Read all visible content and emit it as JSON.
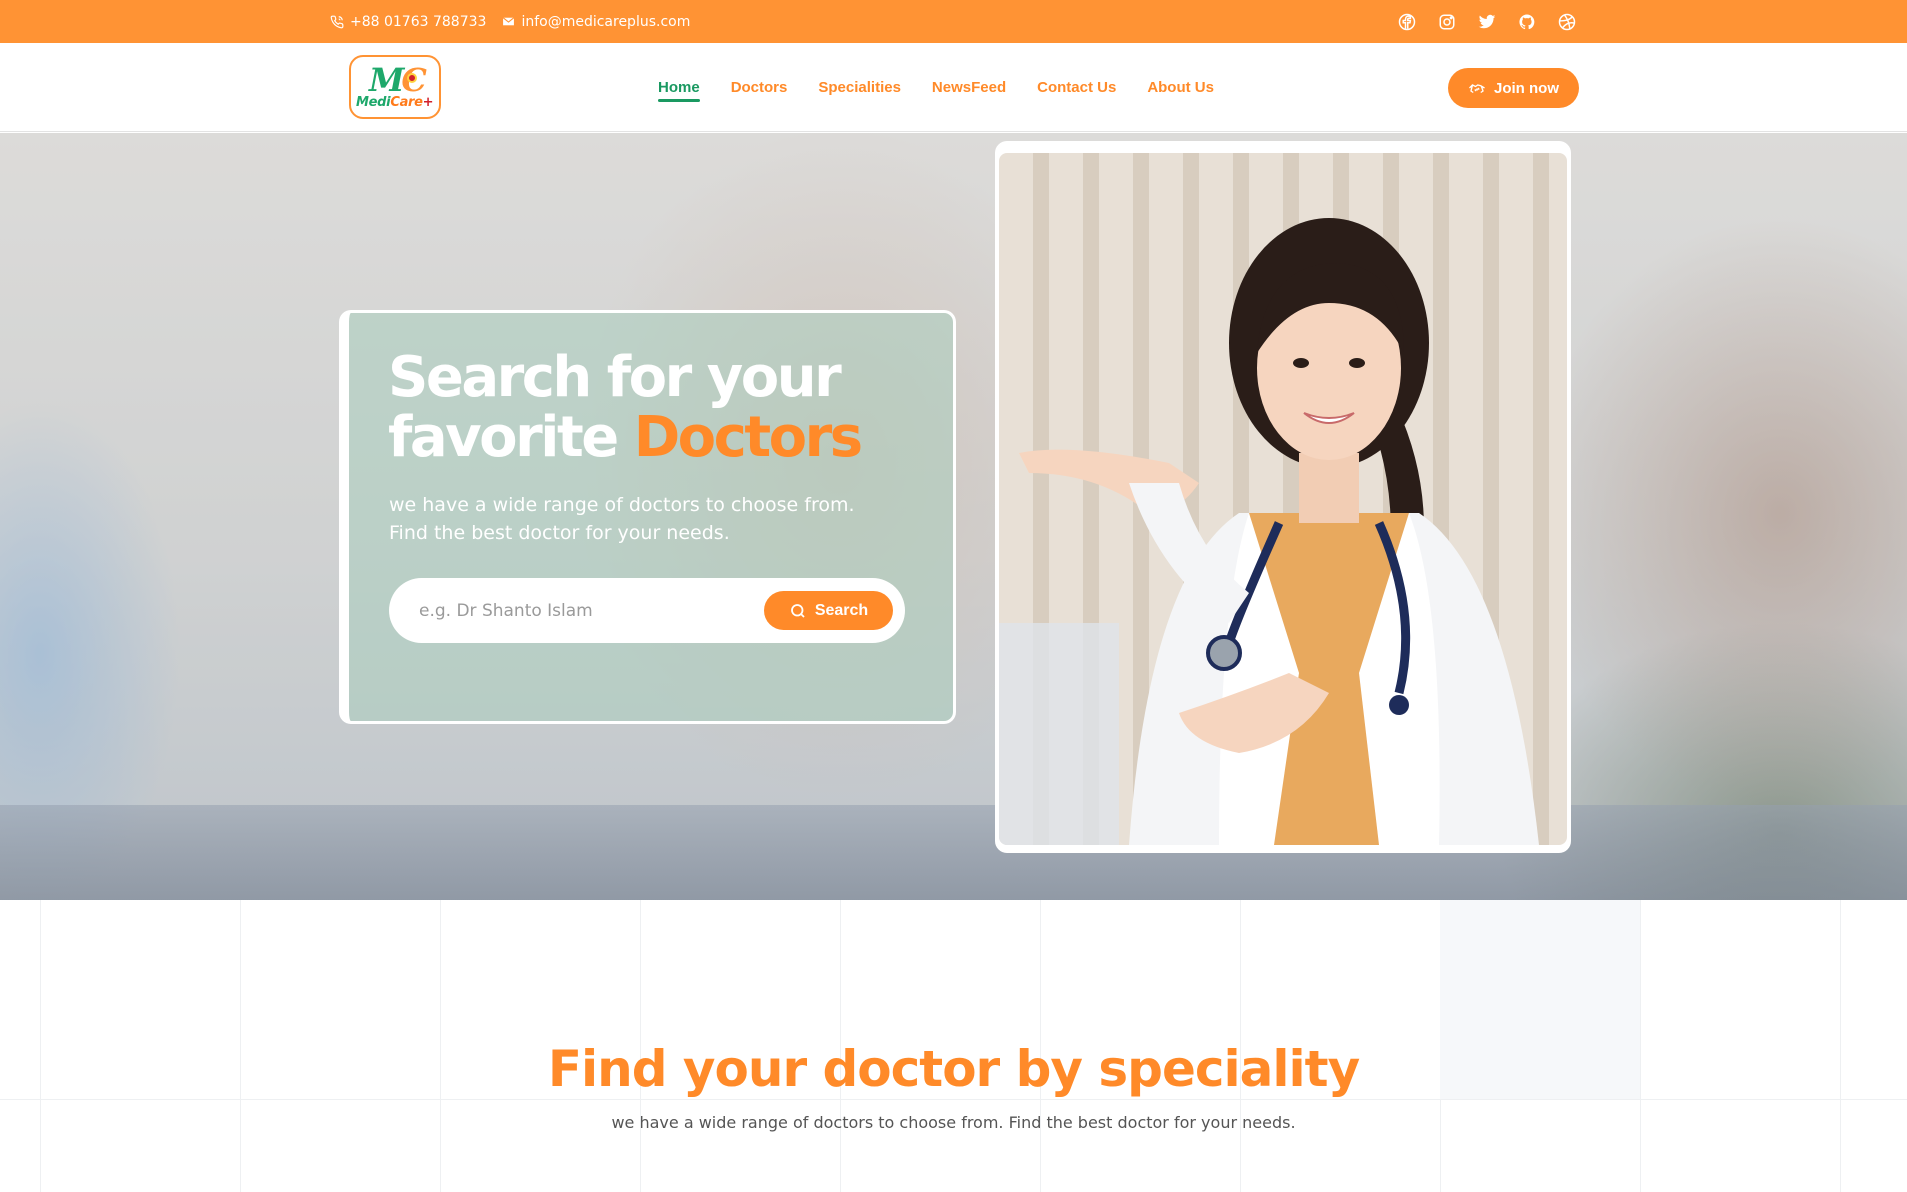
{
  "topbar": {
    "phone": "+88 01763 788733",
    "email": "info@medicareplus.com",
    "social": [
      "facebook-icon",
      "instagram-icon",
      "twitter-icon",
      "github-icon",
      "dribbble-icon"
    ]
  },
  "brand": {
    "mark_m": "M",
    "mark_c": "C",
    "word_medi": "Medi",
    "word_care": "Care",
    "word_plus": "+"
  },
  "nav": {
    "items": [
      {
        "label": "Home",
        "active": true
      },
      {
        "label": "Doctors"
      },
      {
        "label": "Specialities"
      },
      {
        "label": "NewsFeed"
      },
      {
        "label": "Contact Us"
      },
      {
        "label": "About Us"
      }
    ],
    "join_label": "Join now"
  },
  "hero": {
    "headline_line1": "Search for your",
    "headline_line2": "favorite ",
    "headline_accent": "Doctors",
    "subtext_line1": "we have a wide range of doctors to choose from.",
    "subtext_line2": "Find the best doctor for your needs.",
    "search_placeholder": "e.g. Dr Shanto Islam",
    "search_button": "Search"
  },
  "speciality": {
    "title": "Find your doctor by speciality",
    "subtitle": "we have a wide range of doctors to choose from. Find the best doctor for your needs."
  },
  "colors": {
    "accent": "#ff8a29",
    "topbar": "#ff9334",
    "active_nav": "#1a9961"
  }
}
